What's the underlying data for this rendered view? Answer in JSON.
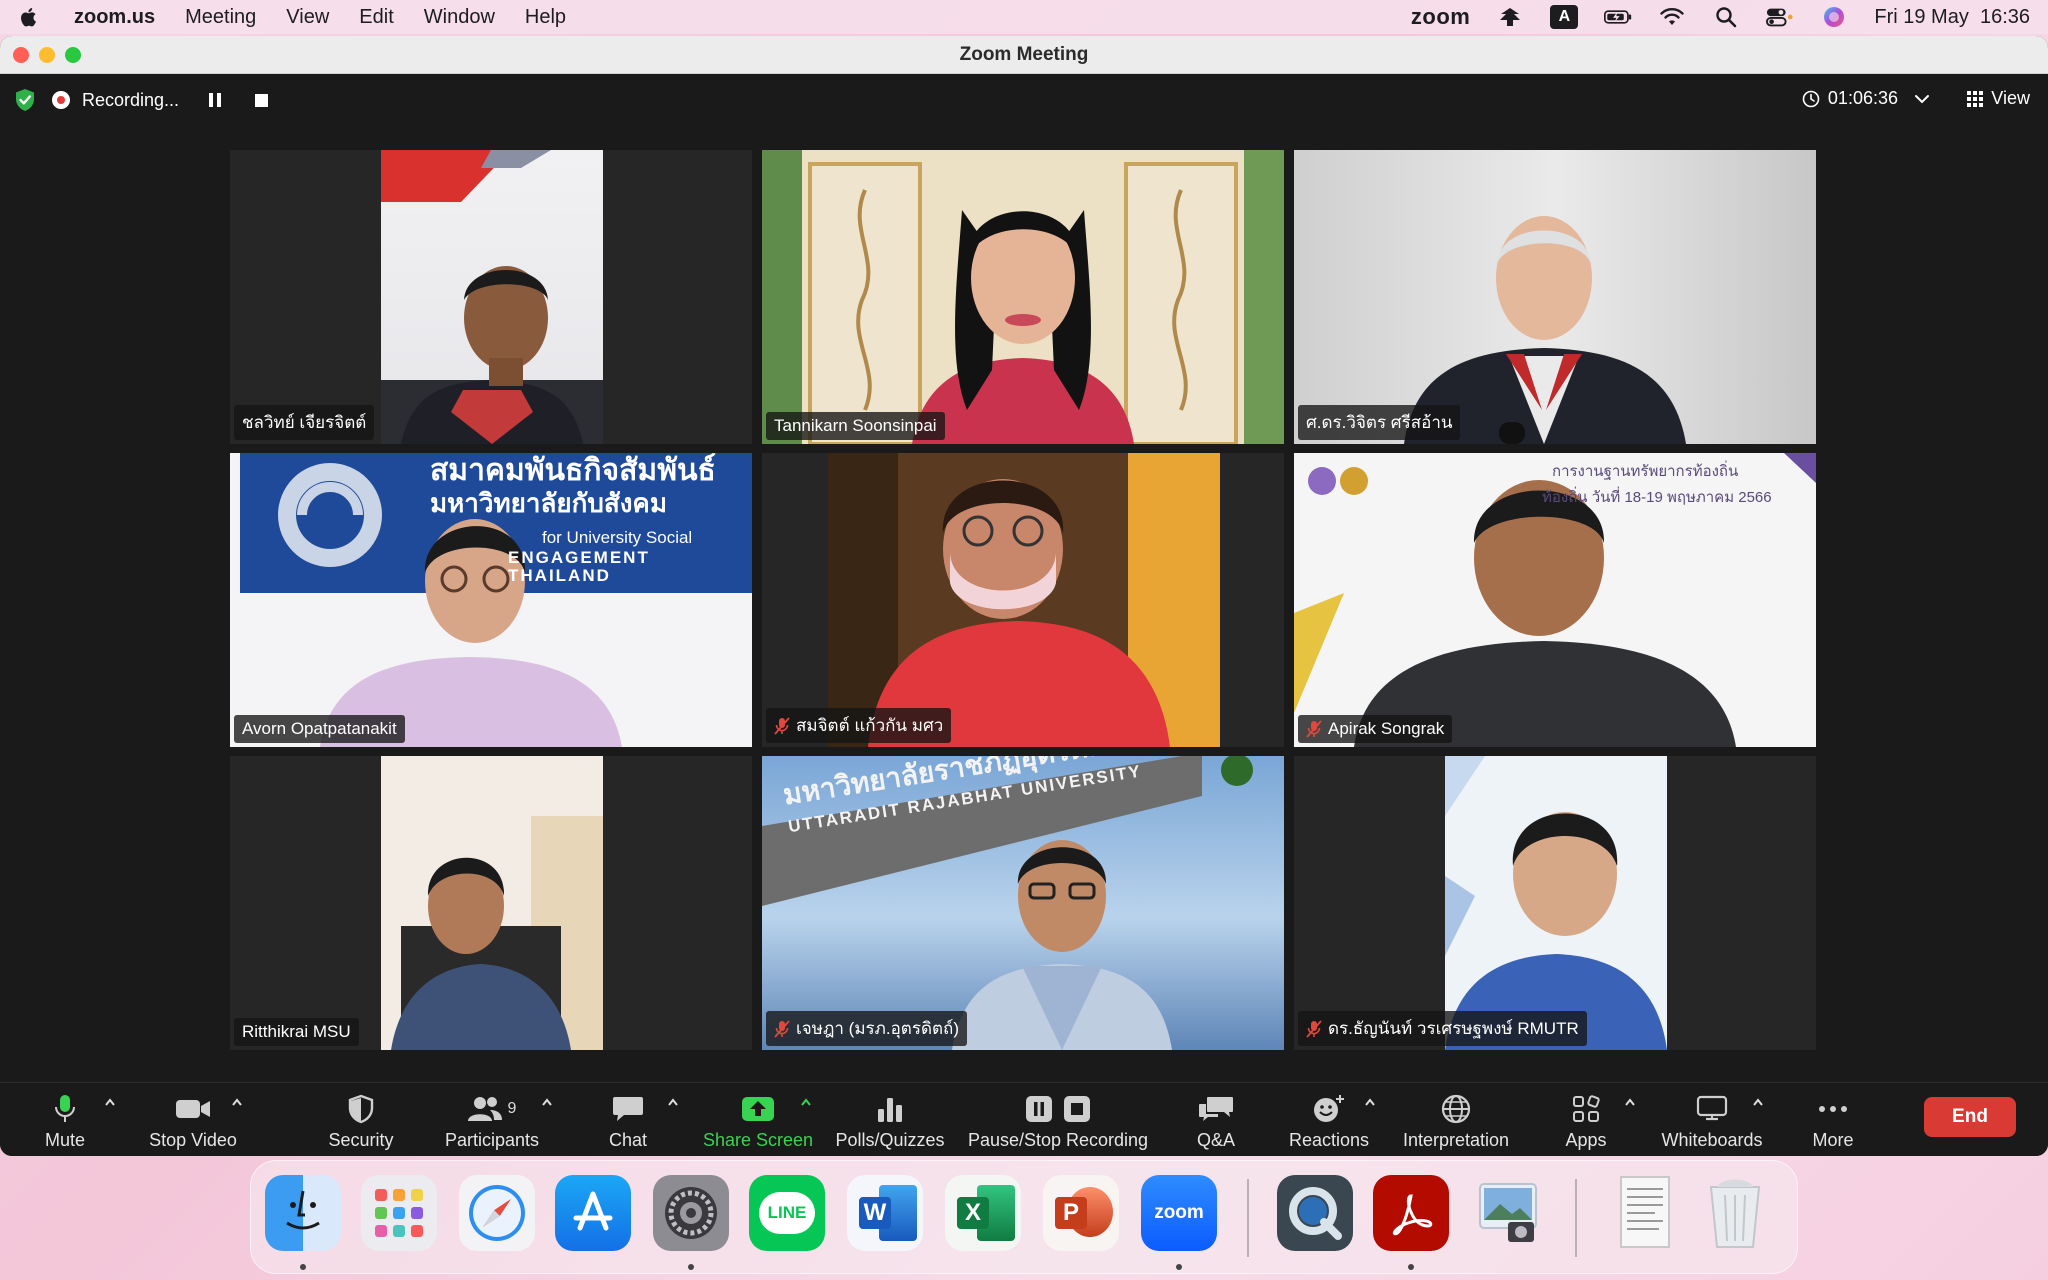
{
  "menubar": {
    "app_name": "zoom.us",
    "items": [
      "Meeting",
      "View",
      "Edit",
      "Window",
      "Help"
    ],
    "zoom_label": "zoom",
    "input_source": "A",
    "datetime": "Fri 19 May  16:36"
  },
  "window": {
    "title": "Zoom Meeting"
  },
  "meeting": {
    "recording_label": "Recording...",
    "elapsed": "01:06:36",
    "view_label": "View"
  },
  "participants": [
    {
      "name": "ชลวิทย์ เจียรจิตต์",
      "muted": false,
      "active": false
    },
    {
      "name": "Tannikarn Soonsinpai",
      "muted": false,
      "active": true
    },
    {
      "name": "ศ.ดร.วิจิตร ศรีสอ้าน",
      "muted": false,
      "active": false
    },
    {
      "name": "Avorn Opatpatanakit",
      "muted": false,
      "active": false
    },
    {
      "name": "สมจิตต์ แก้วกัน มศว",
      "muted": true,
      "active": false
    },
    {
      "name": "Apirak Songrak",
      "muted": true,
      "active": false
    },
    {
      "name": "Ritthikrai MSU",
      "muted": false,
      "active": false
    },
    {
      "name": "เจษฎา (มรภ.อุตรดิตถ์)",
      "muted": true,
      "active": false
    },
    {
      "name": "ดร.ธัญนันท์ วรเศรษฐพงษ์ RMUTR",
      "muted": true,
      "active": false
    }
  ],
  "tile_text": {
    "banner_line1": "สมาคมพันธกิจสัมพันธ์",
    "banner_line2": "มหาวิทยาลัยกับสังคม",
    "banner_line3": "for University Social",
    "banner_line4": "ENGAGEMENT THAILAND",
    "event_line1": "การงานฐานทรัพยากรท้องถิ่น",
    "event_line2": "ท้องถิ่น วันที่ 18-19 พฤษภาคม 2566",
    "sign_line1": "มหาวิทยาลัยราชภัฏอุตรดิตถ์",
    "sign_line2": "UTTARADIT RAJABHAT UNIVERSITY"
  },
  "toolbar": {
    "mute": "Mute",
    "stop_video": "Stop Video",
    "security": "Security",
    "participants": "Participants",
    "participant_count": "9",
    "chat": "Chat",
    "share_screen": "Share Screen",
    "polls": "Polls/Quizzes",
    "recording": "Pause/Stop Recording",
    "qa": "Q&A",
    "reactions": "Reactions",
    "interpretation": "Interpretation",
    "apps": "Apps",
    "whiteboards": "Whiteboards",
    "more": "More",
    "end": "End"
  },
  "dock": {
    "apps": [
      "finder-icon",
      "launchpad-icon",
      "safari-icon",
      "app-store-icon",
      "system-settings-icon",
      "line-icon",
      "word-icon",
      "excel-icon",
      "powerpoint-icon",
      "zoom-icon",
      "quicktime-icon",
      "acrobat-icon",
      "preview-icon",
      "document-icon",
      "trash-icon"
    ],
    "line_label": "LINE",
    "word_label": "W",
    "excel_label": "X",
    "ppt_label": "P",
    "zoom_label": "zoom"
  },
  "colors": {
    "accent_green": "#39d353",
    "end_red": "#d93a33",
    "active_speaker": "#7ec96b"
  }
}
